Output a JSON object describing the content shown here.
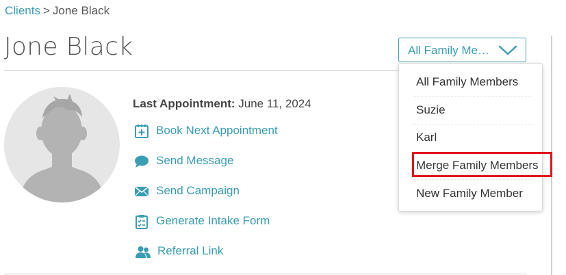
{
  "breadcrumb": {
    "parent": "Clients",
    "separator": ">",
    "current": "Jone Black"
  },
  "page": {
    "title": "Jone Black"
  },
  "family_select": {
    "selected_label": "All Family Me…",
    "options": [
      "All Family Members",
      "Suzie",
      "Karl",
      "Merge Family Members",
      "New Family Member"
    ],
    "highlighted_option": "Merge Family Members"
  },
  "client": {
    "last_appointment_label": "Last Appointment:",
    "last_appointment_value": "June 11, 2024"
  },
  "actions": [
    {
      "label": "Book Next Appointment",
      "icon": "calendar-plus-icon"
    },
    {
      "label": "Send Message",
      "icon": "chat-bubble-icon"
    },
    {
      "label": "Send Campaign",
      "icon": "envelope-icon"
    },
    {
      "label": "Generate Intake Form",
      "icon": "clipboard-checklist-icon"
    },
    {
      "label": "Referral Link",
      "icon": "users-icon"
    }
  ],
  "colors": {
    "accent": "#3a9db2",
    "highlight": "#e0141c",
    "avatar_bg": "#e6e6e6",
    "avatar_fg": "#b3b3b3"
  }
}
